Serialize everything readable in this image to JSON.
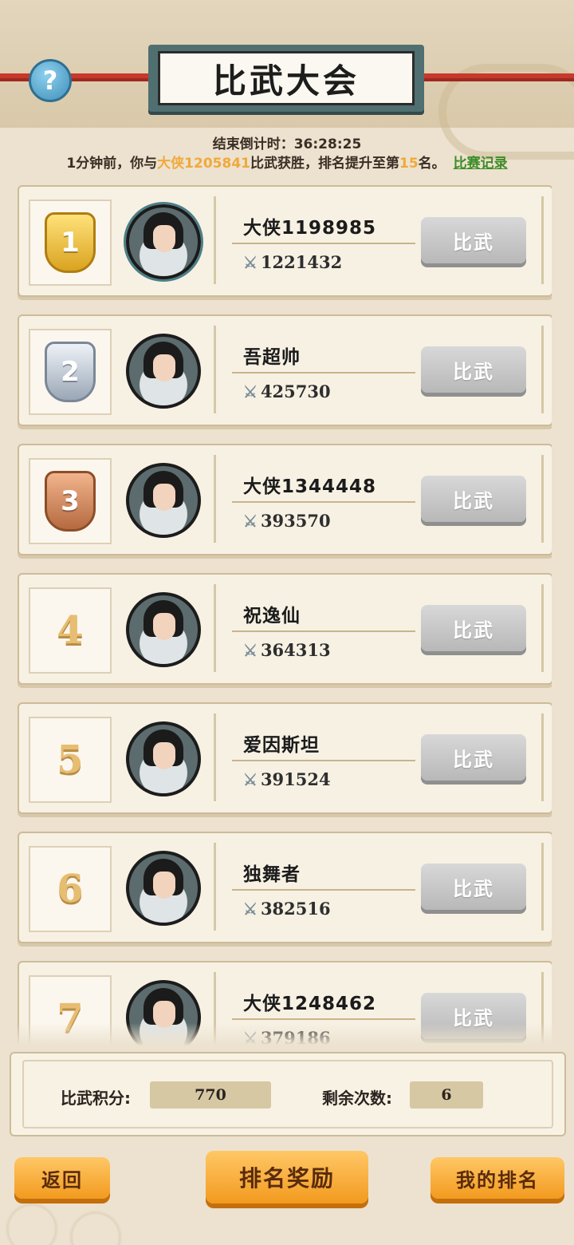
{
  "header": {
    "title": "比武大会",
    "help_label": "?"
  },
  "countdown": {
    "label": "结束倒计时：",
    "value": "36:28:25"
  },
  "announcement": {
    "prefix": "1分钟前，你与",
    "opponent": "大侠1205841",
    "middle": "比武获胜，排名提升至第",
    "rank": "15",
    "suffix": "名。",
    "link": "比赛记录"
  },
  "players": [
    {
      "rank": "1",
      "name": "大侠1198985",
      "power": "1221432",
      "button": "比武",
      "medal": "gold"
    },
    {
      "rank": "2",
      "name": "吾超帅",
      "power": "425730",
      "button": "比武",
      "medal": "silver"
    },
    {
      "rank": "3",
      "name": "大侠1344448",
      "power": "393570",
      "button": "比武",
      "medal": "bronze"
    },
    {
      "rank": "4",
      "name": "祝逸仙",
      "power": "364313",
      "button": "比武"
    },
    {
      "rank": "5",
      "name": "爱因斯坦",
      "power": "391524",
      "button": "比武"
    },
    {
      "rank": "6",
      "name": "独舞者",
      "power": "382516",
      "button": "比武"
    },
    {
      "rank": "7",
      "name": "大侠1248462",
      "power": "379186",
      "button": "比武"
    }
  ],
  "stats": {
    "score_label": "比武积分:",
    "score_value": "770",
    "remaining_label": "剩余次数:",
    "remaining_value": "6"
  },
  "footer": {
    "back": "返回",
    "rewards": "排名奖励",
    "my_rank": "我的排名"
  },
  "colors": {
    "accent": "#f0a93a",
    "link": "#3d8c27",
    "button_orange": "#f29a1e",
    "button_grey": "#c6c6c6"
  }
}
